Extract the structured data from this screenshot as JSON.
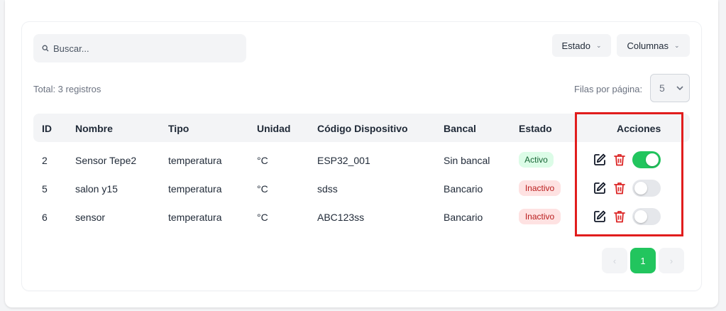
{
  "toolbar": {
    "search_placeholder": "Buscar...",
    "estado_label": "Estado",
    "columnas_label": "Columnas",
    "chevron": "⌄"
  },
  "summary": {
    "total": "Total: 3 registros",
    "filas_label": "Filas por página:",
    "filas_value": "5"
  },
  "table": {
    "headers": [
      "ID",
      "Nombre",
      "Tipo",
      "Unidad",
      "Código Dispositivo",
      "Bancal",
      "Estado",
      "Acciones"
    ],
    "rows": [
      {
        "id": "2",
        "nombre": "Sensor Tepe2",
        "tipo": "temperatura",
        "unidad": "°C",
        "codigo": "ESP32_001",
        "bancal": "Sin bancal",
        "estado": "Activo",
        "toggle_on": true
      },
      {
        "id": "5",
        "nombre": "salon y15",
        "tipo": "temperatura",
        "unidad": "°C",
        "codigo": "sdss",
        "bancal": "Bancario",
        "estado": "Inactivo",
        "toggle_on": false
      },
      {
        "id": "6",
        "nombre": "sensor",
        "tipo": "temperatura",
        "unidad": "°C",
        "codigo": "ABC123ss",
        "bancal": "Bancario",
        "estado": "Inactivo",
        "toggle_on": false
      }
    ]
  },
  "pagination": {
    "prev": "‹",
    "page": "1",
    "next": "›"
  },
  "colors": {
    "accent_green": "#22c55e",
    "danger_red": "#dc2626",
    "highlight_red": "#e11d1d"
  },
  "icons": {
    "search": "search-icon",
    "edit": "edit-icon",
    "delete": "trash-icon"
  }
}
